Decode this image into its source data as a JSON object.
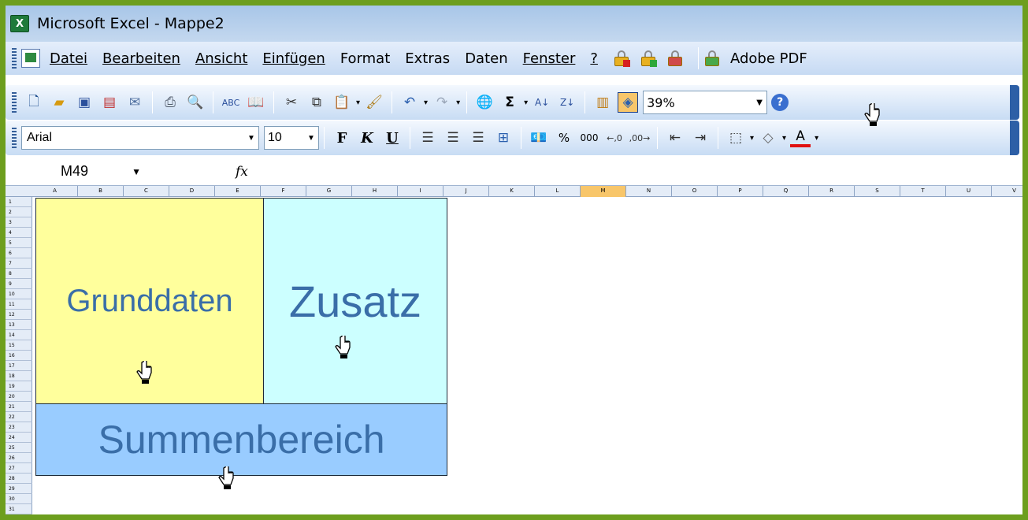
{
  "window": {
    "title": "Microsoft Excel - Mappe2",
    "app_icon": "excel-icon"
  },
  "menu": {
    "items": [
      {
        "label": "Datei",
        "key": "datei"
      },
      {
        "label": "Bearbeiten",
        "key": "bearbeiten"
      },
      {
        "label": "Ansicht",
        "key": "ansicht"
      },
      {
        "label": "Einfügen",
        "key": "einfuegen"
      },
      {
        "label": "Format",
        "key": "format"
      },
      {
        "label": "Extras",
        "key": "extras"
      },
      {
        "label": "Daten",
        "key": "daten"
      },
      {
        "label": "Fenster",
        "key": "fenster"
      },
      {
        "label": "?",
        "key": "hilfe"
      }
    ],
    "adobe": "Adobe PDF"
  },
  "toolbar": {
    "zoom_value": "39%",
    "sigma": "Σ"
  },
  "format_toolbar": {
    "font": "Arial",
    "size": "10",
    "bold": "F",
    "italic": "K",
    "underline": "U",
    "percent": "%",
    "thousands": "000"
  },
  "formula_bar": {
    "name_box": "M49",
    "fx": "fx",
    "formula": ""
  },
  "grid": {
    "columns": [
      "A",
      "B",
      "C",
      "D",
      "E",
      "F",
      "G",
      "H",
      "I",
      "J",
      "K",
      "L",
      "M",
      "N",
      "O",
      "P",
      "Q",
      "R",
      "S",
      "T",
      "U",
      "V"
    ],
    "selected_column": "M",
    "rows": [
      "1",
      "2",
      "3",
      "4",
      "5",
      "6",
      "7",
      "8",
      "9",
      "10",
      "11",
      "12",
      "13",
      "14",
      "15",
      "16",
      "17",
      "18",
      "19",
      "20",
      "21",
      "22",
      "23",
      "24",
      "25",
      "26",
      "27",
      "28",
      "29",
      "30",
      "31"
    ]
  },
  "blocks": {
    "grunddaten": "Grunddaten",
    "zusatz": "Zusatz",
    "summenbereich": "Summenbereich"
  },
  "colors": {
    "frame": "#6d9e1e",
    "grunddaten_fill": "#ffff9c",
    "zusatz_fill": "#ccffff",
    "summen_fill": "#99ccff",
    "block_text": "#3a6ea8"
  }
}
